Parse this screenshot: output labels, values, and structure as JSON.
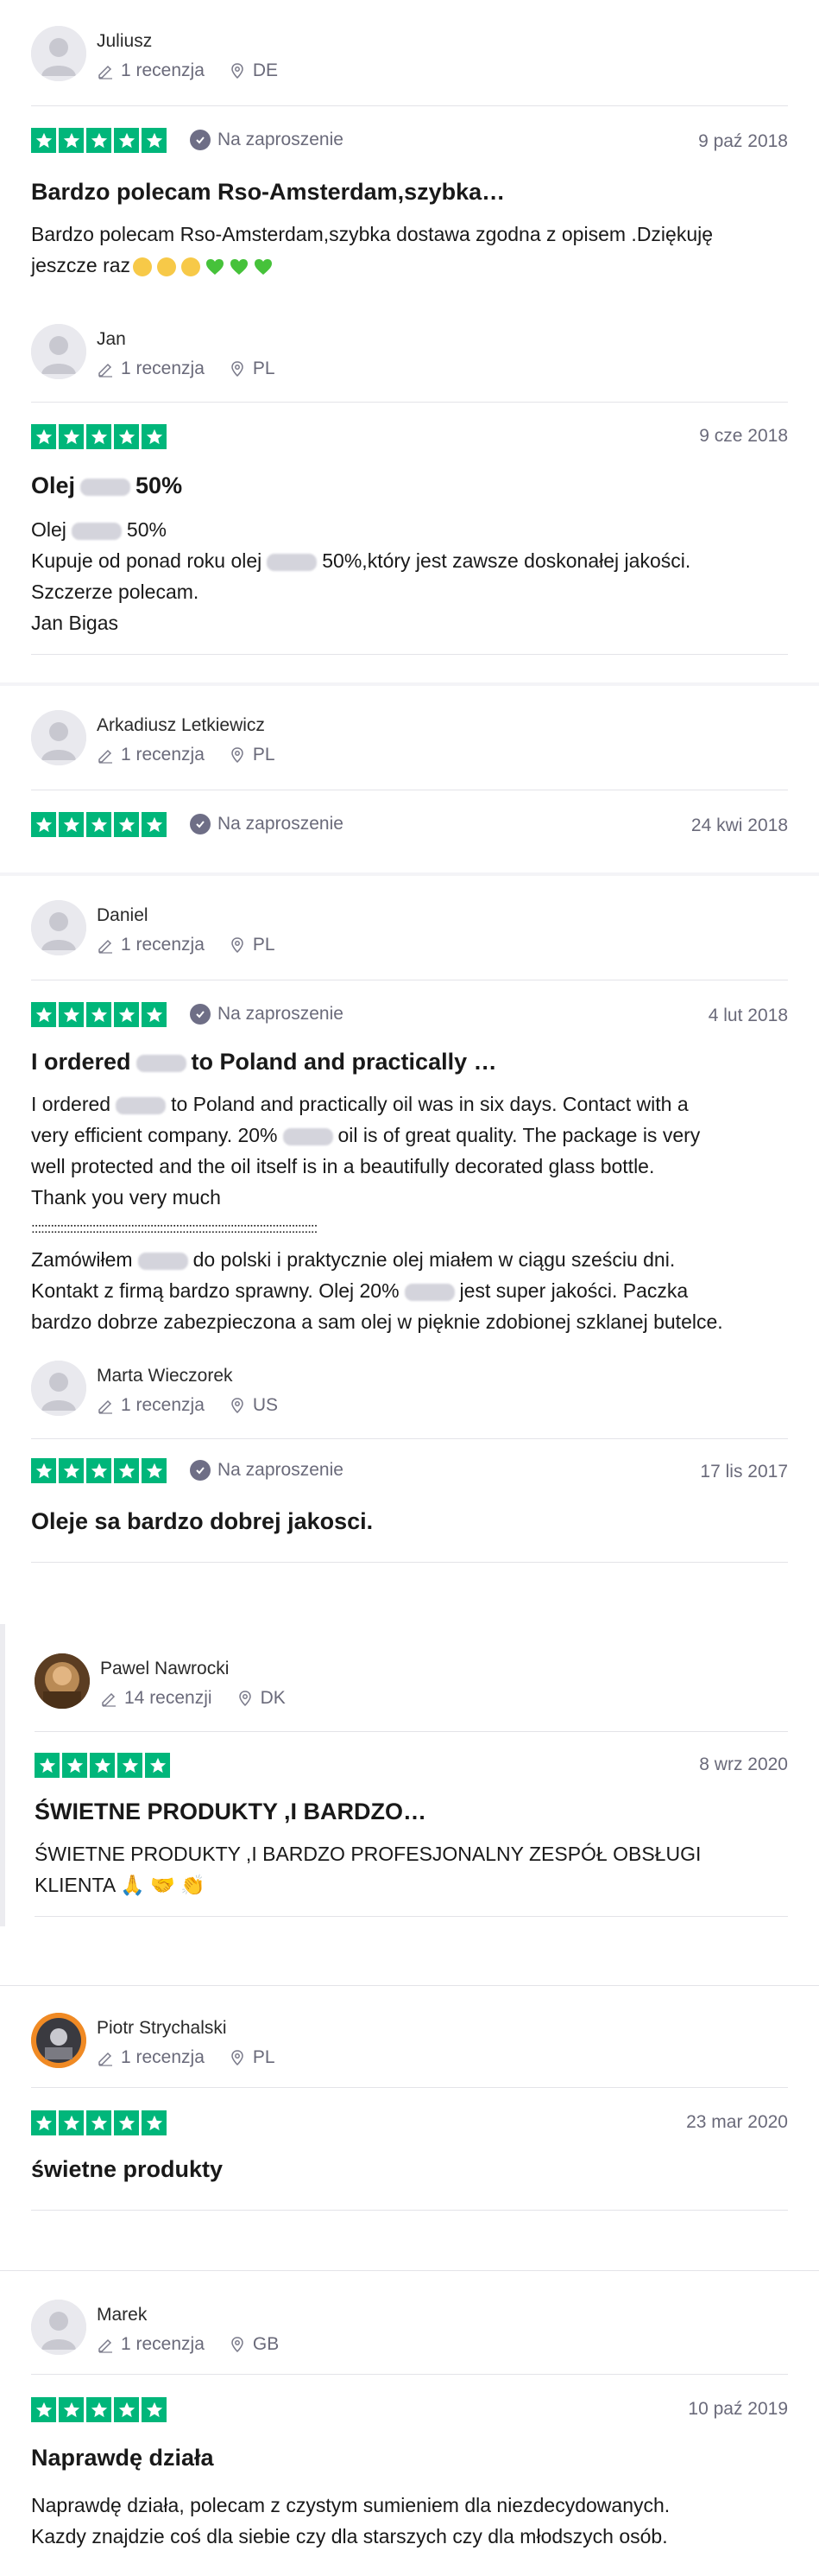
{
  "colors": {
    "star_green": "#00b67a",
    "muted": "#6a6a7a",
    "divider": "#e3e3e8"
  },
  "icons": {
    "pencil": "pencil-icon",
    "location": "location-pin-icon",
    "verified": "verified-check-icon",
    "star": "star-icon"
  },
  "reviews": [
    {
      "author": "Juliusz",
      "reviews_count": "1 recenzja",
      "country": "DE",
      "rating": 5,
      "invited": "Na zaproszenie",
      "date": "9 paź 2018",
      "title": "Bardzo polecam Rso-Amsterdam,szybka…",
      "body": [
        "Bardzo polecam Rso-Amsterdam,szybka dostawa zgodna z opisem .Dziękuję",
        "jeszcze raz"
      ]
    },
    {
      "author": "Jan",
      "reviews_count": "1 recenzja",
      "country": "PL",
      "rating": 5,
      "date": "9 cze 2018",
      "title_pre": "Olej",
      "title_post": "50%",
      "body": [
        {
          "pre": "Olej",
          "post": "50%"
        },
        {
          "pre": "Kupuje od ponad roku olej",
          "post": "50%,który jest zawsze doskonałej jakości."
        },
        "Szczerze polecam.",
        "Jan Bigas"
      ]
    },
    {
      "author": "Arkadiusz Letkiewicz",
      "reviews_count": "1 recenzja",
      "country": "PL",
      "rating": 5,
      "invited": "Na zaproszenie",
      "date": "24 kwi 2018"
    },
    {
      "author": "Daniel",
      "reviews_count": "1 recenzja",
      "country": "PL",
      "rating": 5,
      "invited": "Na zaproszenie",
      "date": "4 lut 2018",
      "title_pre": "I ordered",
      "title_post": "to Poland and practically …",
      "body": [
        {
          "pre": "I ordered",
          "post": "to Poland and practically oil was in six days. Contact with a"
        },
        {
          "pre": "very efficient company. 20%",
          "post": "oil is of great quality. The package is very"
        },
        "well protected and the oil itself is in a beautifully decorated glass bottle.",
        "Thank you very much",
        ":::::::::::::::::::::::::::::::::::::::::::::::::::::::::::::::::::::::::::::::::::::::::",
        {
          "pre": "Zamówiłem",
          "post": "do polski i praktycznie olej miałem w ciągu sześciu dni."
        },
        {
          "pre": "Kontakt z firmą bardzo sprawny. Olej 20%",
          "post": "jest super jakości. Paczka"
        },
        "bardzo dobrze zabezpieczona a sam olej w pięknie zdobionej szklanej butelce."
      ]
    },
    {
      "author": "Marta Wieczorek",
      "reviews_count": "1 recenzja",
      "country": "US",
      "rating": 5,
      "invited": "Na zaproszenie",
      "date": "17 lis 2017",
      "title": "Oleje sa bardzo dobrej jakosci."
    },
    {
      "author": "Pawel Nawrocki",
      "reviews_count": "14 recenzji",
      "country": "DK",
      "rating": 5,
      "date": "8 wrz 2020",
      "title": "ŚWIETNE PRODUKTY ,I BARDZO…",
      "body": [
        "ŚWIETNE PRODUKTY ,I BARDZO PROFESJONALNY ZESPÓŁ OBSŁUGI",
        "KLIENTA"
      ],
      "emoji": "🙏 🤝 👏"
    },
    {
      "author": "Piotr Strychalski",
      "reviews_count": "1 recenzja",
      "country": "PL",
      "rating": 5,
      "date": "23 mar 2020",
      "title": "świetne produkty"
    },
    {
      "author": "Marek",
      "reviews_count": "1 recenzja",
      "country": "GB",
      "rating": 5,
      "date": "10 paź 2019",
      "title": "Naprawdę działa",
      "body": [
        "Naprawdę działa, polecam z czystym sumieniem dla niezdecydowanych.",
        "Kazdy znajdzie coś dla siebie czy dla starszych czy dla młodszych osób."
      ]
    }
  ]
}
